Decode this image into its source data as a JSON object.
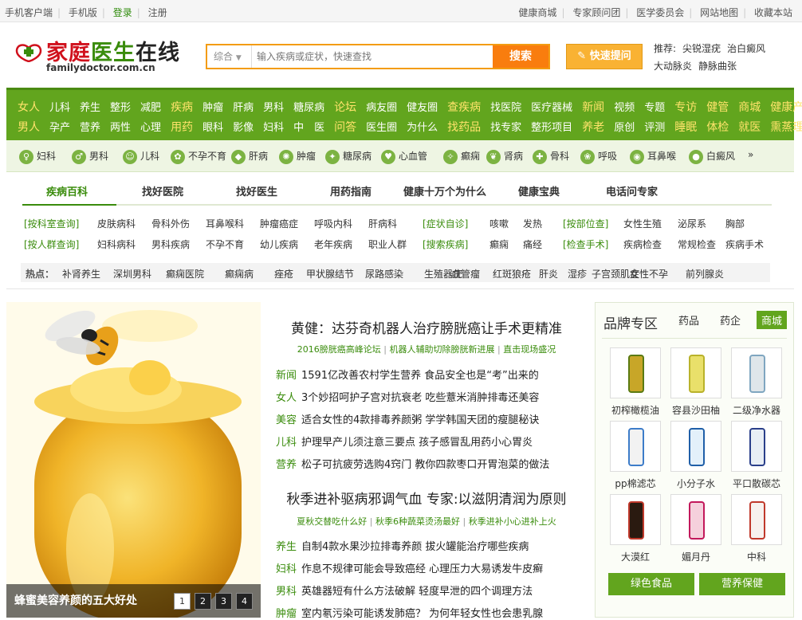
{
  "topbar": {
    "left": [
      "手机客户端",
      "手机版",
      "登录",
      "注册"
    ],
    "right": [
      "健康商城",
      "专家顾问团",
      "医学委员会",
      "网站地图",
      "收藏本站"
    ]
  },
  "logo": {
    "name_a": "家庭",
    "name_b": "医生",
    "name_c": "在线",
    "url": "familydoctor.com.cn"
  },
  "search": {
    "select": "综合",
    "placeholder": "输入疾病或症状，快速查找",
    "button": "搜索"
  },
  "ask": {
    "label": "快速提问"
  },
  "recommend": {
    "label": "推荐:",
    "items": [
      "尖锐湿疣",
      "治白癜风",
      "大动脉炎",
      "静脉曲张"
    ]
  },
  "nav": {
    "row1": [
      "女人",
      "儿科",
      "养生",
      "整形",
      "减肥",
      "疾病",
      "肿瘤",
      "肝病",
      "男科",
      "糖尿病",
      "论坛",
      "病友圈",
      "健友圈",
      "查疾病",
      "找医院",
      "医疗器械",
      "新闻",
      "视频",
      "专题",
      "专访",
      "健管",
      "商城",
      "健康产业"
    ],
    "row2": [
      "男人",
      "孕产",
      "营养",
      "两性",
      "心理",
      "用药",
      "眼科",
      "影像",
      "妇科",
      "中　医",
      "问答",
      "医生圈",
      "为什么",
      "找药品",
      "找专家",
      "整形项目",
      "养老",
      "原创",
      "评测",
      "睡眠",
      "体检",
      "就医",
      "熏蒸理疗"
    ],
    "row1_big": [
      0,
      5,
      10,
      13,
      16,
      19,
      20,
      21,
      22
    ],
    "row2_big": [
      0,
      5,
      10,
      13,
      16,
      19,
      20,
      21,
      22
    ]
  },
  "icons": [
    {
      "label": "妇科",
      "icon": "female-icon"
    },
    {
      "label": "男科",
      "icon": "male-icon"
    },
    {
      "label": "儿科",
      "icon": "child-icon"
    },
    {
      "label": "不孕不育",
      "icon": "infertility-icon"
    },
    {
      "label": "肝病",
      "icon": "liver-icon"
    },
    {
      "label": "肿瘤",
      "icon": "tumor-icon"
    },
    {
      "label": "糖尿病",
      "icon": "diabetes-icon"
    },
    {
      "label": "心血管",
      "icon": "heart-icon"
    },
    {
      "label": "癫痫",
      "icon": "epilepsy-icon"
    },
    {
      "label": "肾病",
      "icon": "kidney-icon"
    },
    {
      "label": "骨科",
      "icon": "bone-icon"
    },
    {
      "label": "呼吸",
      "icon": "lung-icon"
    },
    {
      "label": "耳鼻喉",
      "icon": "ent-icon"
    },
    {
      "label": "白癜风",
      "icon": "vitiligo-icon"
    }
  ],
  "tabs": [
    "疾病百科",
    "找好医院",
    "找好医生",
    "用药指南",
    "健康十万个为什么",
    "健康宝典",
    "电话问专家"
  ],
  "links1": [
    "[按科室查询]",
    "皮肤病科",
    "骨科外伤",
    "耳鼻喉科",
    "肿瘤癌症",
    "呼吸内科",
    "肝病科",
    "[症状自诊]",
    "咳嗽",
    "发热",
    "[按部位查]",
    "女性生殖",
    "泌尿系",
    "胸部"
  ],
  "links2": [
    "[按人群查询]",
    "妇科病科",
    "男科疾病",
    "不孕不育",
    "幼儿疾病",
    "老年疾病",
    "职业人群",
    "[搜索疾病]",
    "癫痫",
    "痛经",
    "[检查手术]",
    "疾病检查",
    "常规检查",
    "疾病手术"
  ],
  "hot": {
    "label": "热点：",
    "items": [
      "补肾养生",
      "深圳男科",
      "癫痫医院",
      "癫痫病",
      "痤疮",
      "甲状腺结节",
      "尿路感染",
      "生殖器疣",
      "血管瘤",
      "红斑狼疮",
      "肝炎",
      "湿疹",
      "子宫颈肌症",
      "女性不孕",
      "前列腺炎"
    ]
  },
  "photo": {
    "caption": "蜂蜜美容养颜的五大好处",
    "pages": [
      "1",
      "2",
      "3",
      "4"
    ],
    "active_page": "1"
  },
  "news": {
    "headline1": "黄健：达芬奇机器人治疗膀胱癌让手术更精准",
    "sub1": [
      "2016膀胱癌高峰论坛",
      "机器人辅助切除膀胱新进展",
      "直击现场盛况"
    ],
    "lines1": [
      {
        "cat": "新闻",
        "text": "1591亿改善农村学生营养 食品安全也是“考”出来的"
      },
      {
        "cat": "女人",
        "text": "3个妙招呵护子宫对抗衰老 吃些薏米消肿排毒还美容"
      },
      {
        "cat": "美容",
        "text": "适合女性的4款排毒养颜粥 学学韩国天团的瘦腿秘诀"
      },
      {
        "cat": "儿科",
        "text": "护理早产儿须注意三要点 孩子感冒乱用药小心胃炎"
      },
      {
        "cat": "营养",
        "text": "松子可抗疲劳选购4窍门 教你四款枣口开胃泡菜的做法"
      }
    ],
    "headline2": "秋季进补驱病邪调气血 专家:以滋阴清润为原则",
    "sub2": [
      "夏秋交替吃什么好",
      "秋季6种蔬菜烫汤最好",
      "秋季进补小心进补上火"
    ],
    "lines2": [
      {
        "cat": "养生",
        "text": "自制4款水果沙拉排毒养颜 拔火罐能治疗哪些疾病"
      },
      {
        "cat": "妇科",
        "text": "作息不规律可能会导致癌经 心理压力大易诱发牛皮癣"
      },
      {
        "cat": "男科",
        "text": "英雄器短有什么方法破解 轻度早泄的四个调理方法"
      },
      {
        "cat": "肿瘤",
        "text": "室内氡污染可能诱发肺癌？ 为何年轻女性也会患乳腺"
      }
    ]
  },
  "brand": {
    "title": "品牌专区",
    "tabs": [
      "药品",
      "药企",
      "商城"
    ],
    "active_tab": "商城",
    "products": [
      "初榨橄榄油",
      "容县沙田柚",
      "二级净水器",
      "pp棉滤芯",
      "小分子水",
      "平口散碳芯",
      "大漠红",
      "媚月丹",
      "中科"
    ],
    "buttons": [
      "绿色食品",
      "营养保健"
    ]
  },
  "colors": {
    "green": "#62a51e",
    "dark_green": "#3a8c0c",
    "orange": "#f97d0e",
    "red": "#d0101c"
  }
}
